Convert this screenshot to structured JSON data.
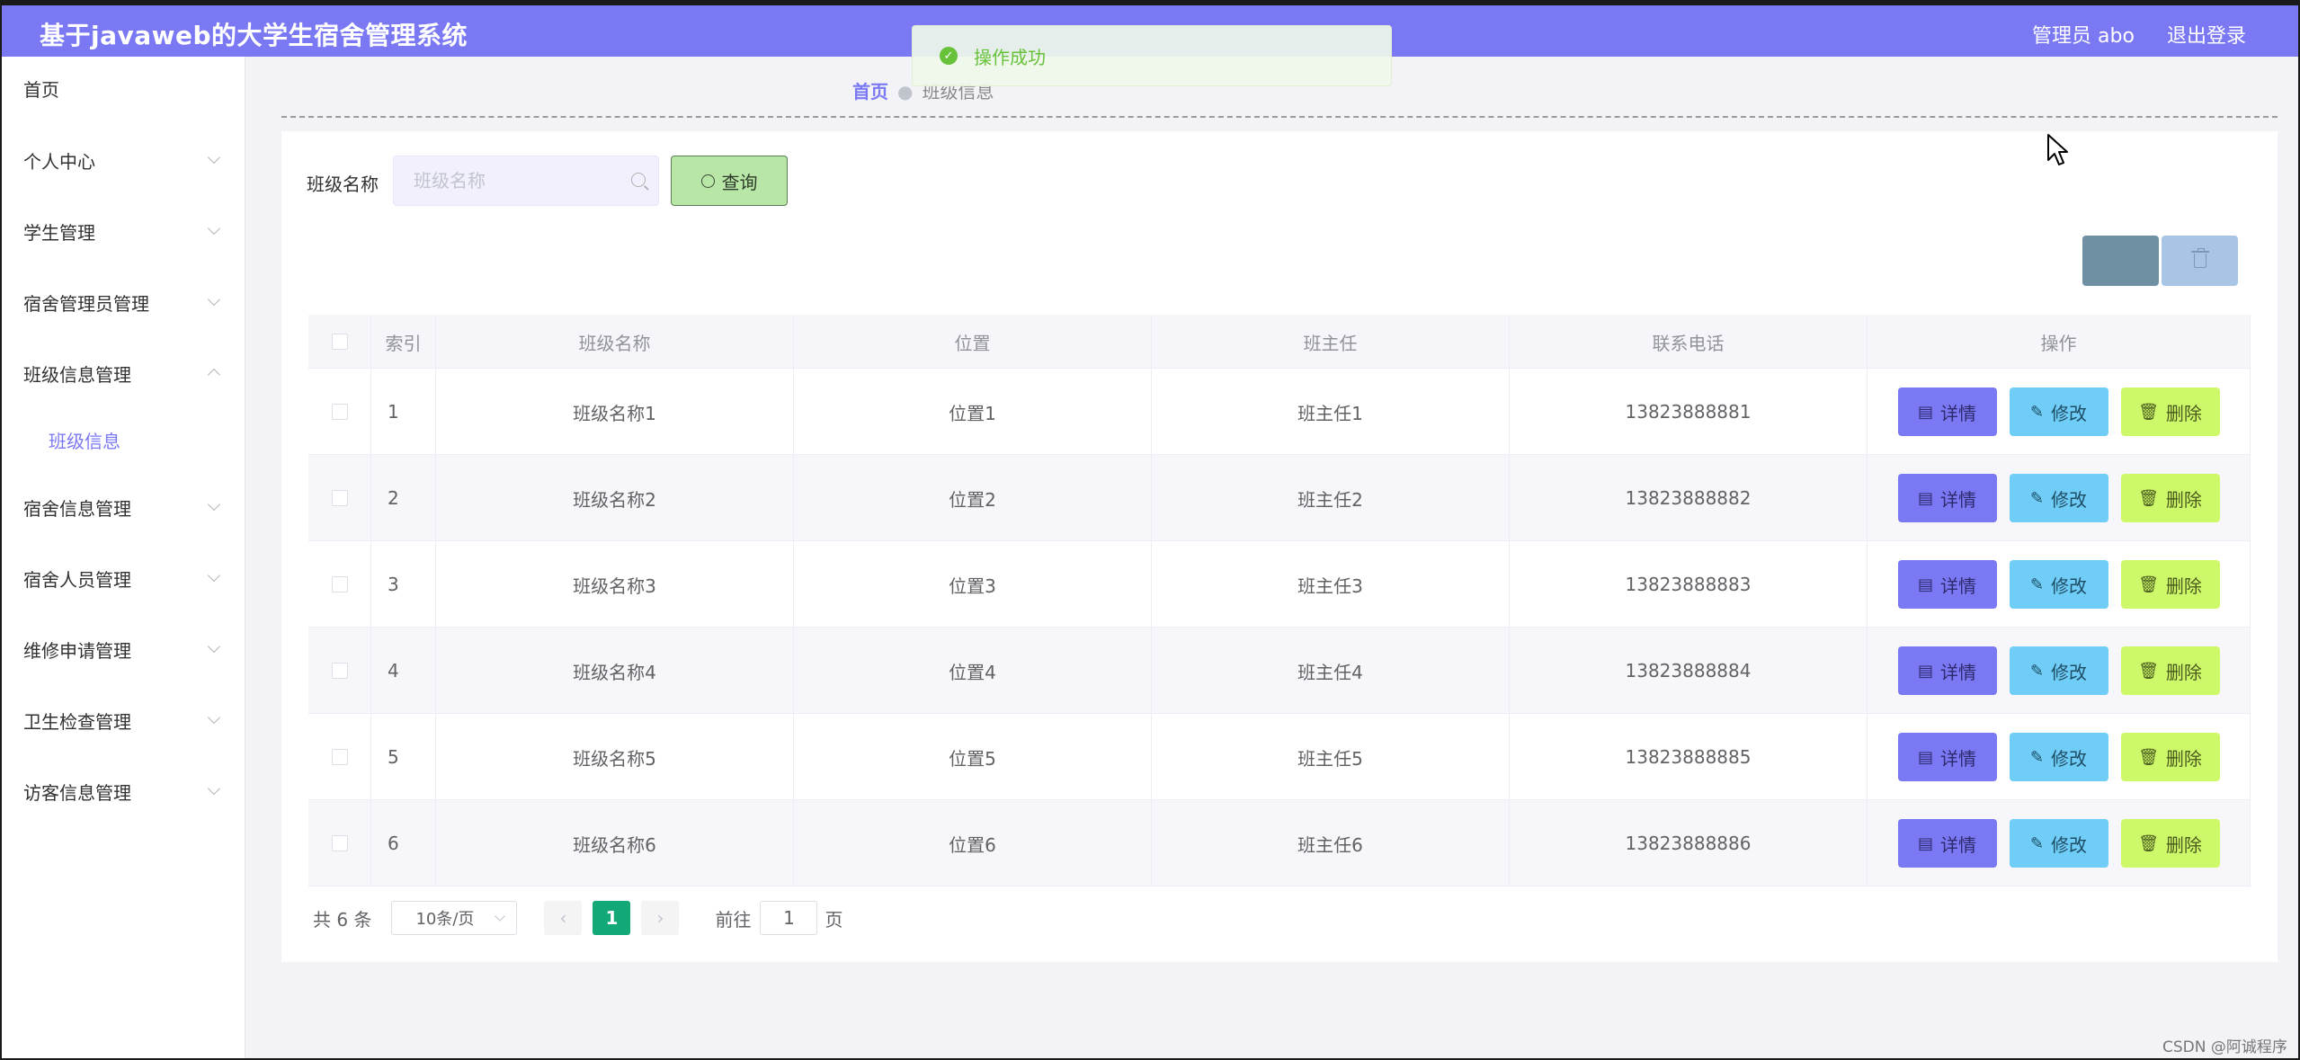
{
  "header": {
    "title": "基于javaweb的大学生宿舍管理系统",
    "user": "管理员 abo",
    "logout": "退出登录"
  },
  "toast": {
    "message": "操作成功"
  },
  "breadcrumb": {
    "home": "首页",
    "current": "班级信息"
  },
  "sidebar": {
    "items": [
      {
        "label": "首页"
      },
      {
        "label": "个人中心"
      },
      {
        "label": "学生管理"
      },
      {
        "label": "宿舍管理员管理"
      },
      {
        "label": "班级信息管理"
      },
      {
        "label": "班级信息"
      },
      {
        "label": "宿舍信息管理"
      },
      {
        "label": "宿舍人员管理"
      },
      {
        "label": "维修申请管理"
      },
      {
        "label": "卫生检查管理"
      },
      {
        "label": "访客信息管理"
      }
    ]
  },
  "search": {
    "label": "班级名称",
    "placeholder": "班级名称",
    "button": "查询"
  },
  "table": {
    "columns": [
      "索引",
      "班级名称",
      "位置",
      "班主任",
      "联系电话",
      "操作"
    ],
    "rows": [
      {
        "index": "1",
        "name": "班级名称1",
        "location": "位置1",
        "teacher": "班主任1",
        "phone": "13823888881"
      },
      {
        "index": "2",
        "name": "班级名称2",
        "location": "位置2",
        "teacher": "班主任2",
        "phone": "13823888882"
      },
      {
        "index": "3",
        "name": "班级名称3",
        "location": "位置3",
        "teacher": "班主任3",
        "phone": "13823888883"
      },
      {
        "index": "4",
        "name": "班级名称4",
        "location": "位置4",
        "teacher": "班主任4",
        "phone": "13823888884"
      },
      {
        "index": "5",
        "name": "班级名称5",
        "location": "位置5",
        "teacher": "班主任5",
        "phone": "13823888885"
      },
      {
        "index": "6",
        "name": "班级名称6",
        "location": "位置6",
        "teacher": "班主任6",
        "phone": "13823888886"
      }
    ],
    "actions": {
      "detail": "详情",
      "edit": "修改",
      "delete": "删除"
    }
  },
  "pagination": {
    "total": "共 6 条",
    "page_size": "10条/页",
    "current": "1",
    "goto_label": "前往",
    "goto_value": "1",
    "page_unit": "页"
  },
  "watermark": "CSDN @阿诚程序",
  "colors": {
    "header": "#7b78f4",
    "detail": "#7b78f4",
    "edit": "#6fcdf7",
    "delete": "#cdf86a",
    "page_active": "#13a877"
  }
}
